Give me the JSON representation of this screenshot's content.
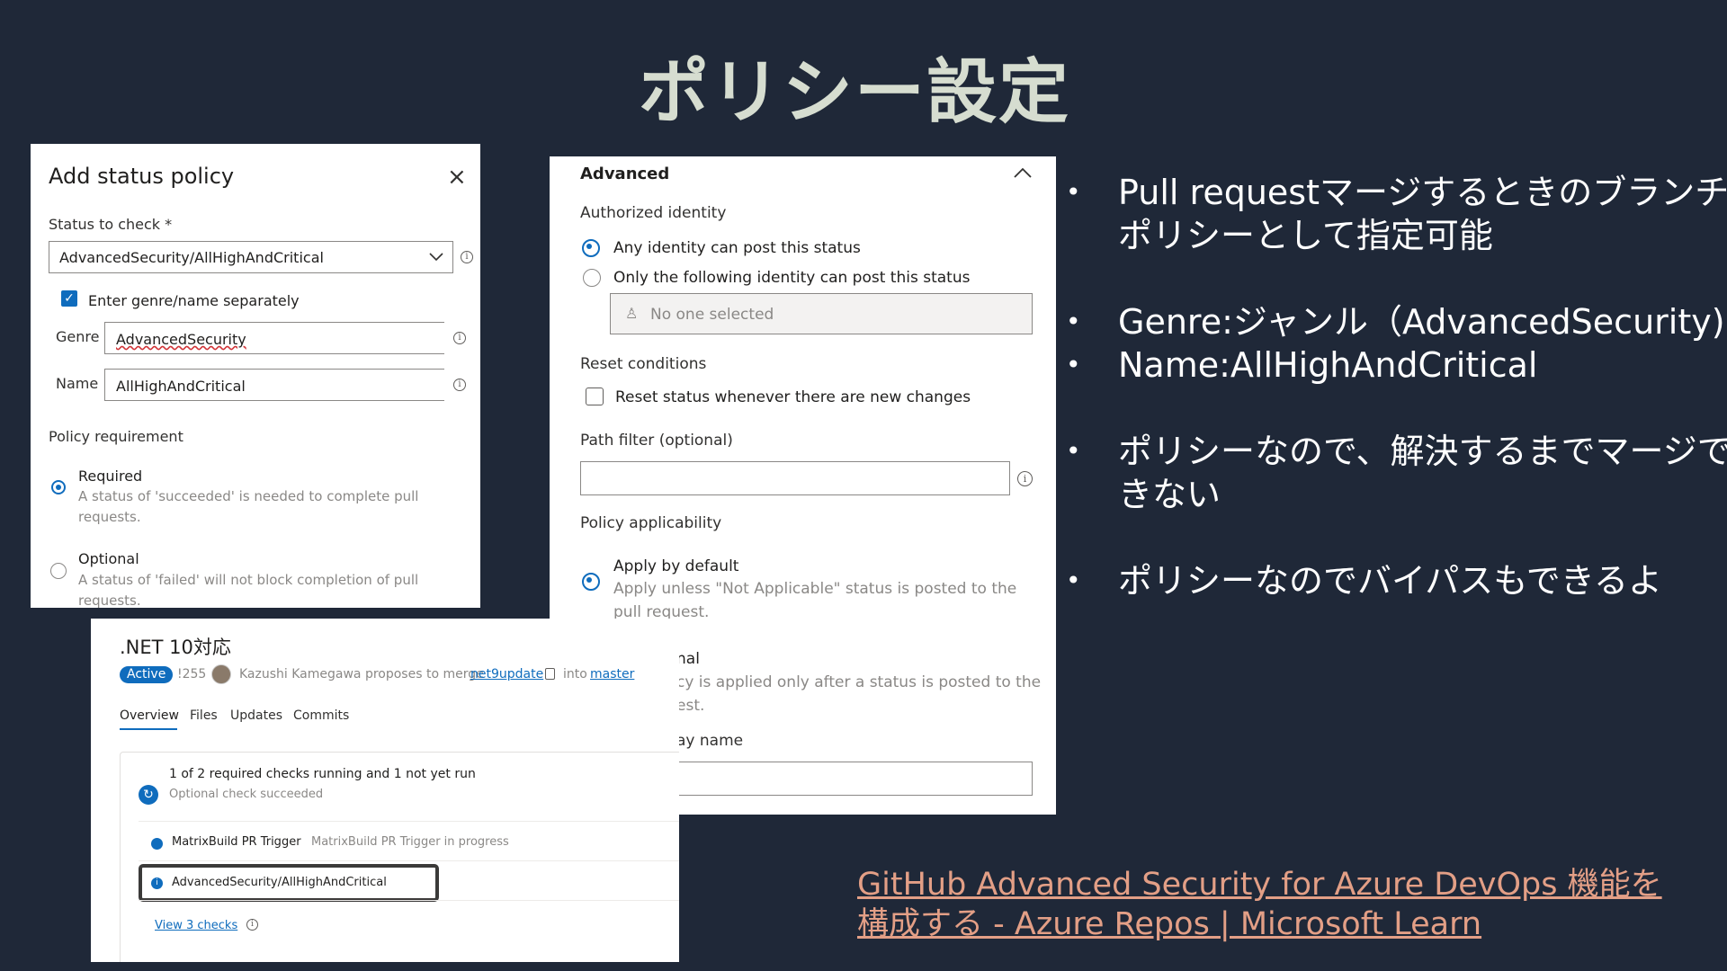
{
  "slide": {
    "title": "ポリシー設定",
    "bullets": [
      {
        "lines": [
          "Pull requestマージするときのブランチ",
          "ポリシーとして指定可能"
        ]
      },
      {
        "lines": [
          "Genre:ジャンル（AdvancedSecurity)"
        ]
      },
      {
        "lines": [
          "Name:AllHighAndCritical"
        ]
      },
      {
        "lines": [
          "ポリシーなので、解決するまでマージで",
          "きない"
        ]
      },
      {
        "lines": [
          "ポリシーなのでバイパスもできるよ"
        ]
      }
    ],
    "link": {
      "line1": "GitHub Advanced Security for Azure DevOps 機能を",
      "line2": "構成する - Azure Repos | Microsoft Learn"
    }
  },
  "status_policy_dialog": {
    "title": "Add status policy",
    "close": "×",
    "status_label": "Status to check *",
    "status_value": "AdvancedSecurity/AllHighAndCritical",
    "separate_checkbox": {
      "label": "Enter genre/name separately",
      "checked": true
    },
    "genre_label": "Genre",
    "genre_value": "AdvancedSecurity",
    "name_label": "Name",
    "name_value": "AllHighAndCritical",
    "requirement_label": "Policy requirement",
    "required_label": "Required",
    "required_desc_1": "A status of 'succeeded' is needed to complete pull",
    "required_desc_2": "requests.",
    "optional_label": "Optional",
    "optional_desc_1": "A status of 'failed' will not block completion of pull",
    "optional_desc_2": "requests."
  },
  "advanced_panel": {
    "header": "Advanced",
    "authorized_identity_label": "Authorized identity",
    "any_identity": "Any identity can post this status",
    "only_identity": "Only the following identity can post this status",
    "identity_placeholder": "No one selected",
    "reset_conditions_label": "Reset conditions",
    "reset_status": "Reset status whenever there are new changes",
    "path_filter_label": "Path filter (optional)",
    "policy_applicability_label": "Policy applicability",
    "apply_default": "Apply by default",
    "apply_default_desc_1": "Apply unless \"Not Applicable\" status is posted to the",
    "apply_default_desc_2": "pull request.",
    "conditional_fragment": "nal",
    "conditional_desc_1": "cy is applied only after a status is posted to the",
    "conditional_desc_2": "est.",
    "display_name_fragment": "ay name"
  },
  "pull_request": {
    "title": ".NET 10対応",
    "status_badge": "Active",
    "pr_id": "!255",
    "author_text": "Kazushi Kamegawa proposes to merge",
    "source_branch": "net9update",
    "into": "into",
    "target_branch": "master",
    "tabs": [
      "Overview",
      "Files",
      "Updates",
      "Commits"
    ],
    "checks_summary": "1 of 2 required checks running and 1 not yet run",
    "checks_sub": "Optional check succeeded",
    "check_1_name": "MatrixBuild PR Trigger",
    "check_1_status": "MatrixBuild PR Trigger in progress",
    "check_2_name": "AdvancedSecurity/AllHighAndCritical",
    "view_checks": "View 3 checks"
  },
  "colors": {
    "background": "#1f2838",
    "accent_blue": "#0f6cbd",
    "link": "#e39f86",
    "title": "#d6ddd0"
  }
}
